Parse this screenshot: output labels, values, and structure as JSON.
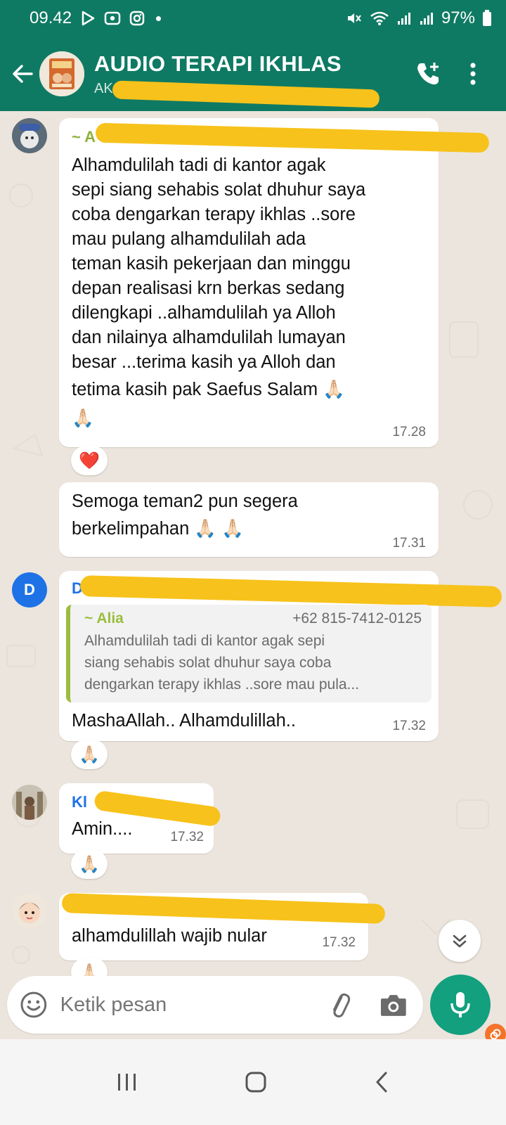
{
  "status_bar": {
    "time": "09.42",
    "battery": "97%"
  },
  "header": {
    "title": "AUDIO TERAPI IKHLAS",
    "subtitle": "AK"
  },
  "messages": [
    {
      "sender": "~ A",
      "text_lines": [
        "Alhamdulilah tadi di kantor agak",
        "sepi siang sehabis solat dhuhur saya",
        "coba dengarkan terapy ikhlas ..sore",
        "mau pulang alhamdulilah ada",
        "teman kasih pekerjaan dan minggu",
        "depan realisasi krn berkas sedang",
        "dilengkapi ..alhamdulilah ya Alloh",
        "dan nilainya alhamdulilah lumayan",
        "besar ...terima kasih  ya Alloh dan",
        "tetima kasih pak Saefus Salam 🙏🏻",
        "🙏🏻"
      ],
      "time": "17.28",
      "reaction": "❤️"
    },
    {
      "text_lines": [
        "Semoga teman2 pun segera",
        "berkelimpahan 🙏🏻 🙏🏻"
      ],
      "time": "17.31"
    },
    {
      "sender": "D",
      "avatar_letter": "D",
      "quote": {
        "name": "~ Alia",
        "phone": "+62 815-7412-0125",
        "text_lines": [
          "Alhamdulilah tadi di kantor agak sepi",
          "siang sehabis solat dhuhur saya coba",
          "dengarkan terapy ikhlas ..sore mau pula..."
        ]
      },
      "text": "MashaAllah.. Alhamdulillah..",
      "time": "17.32",
      "reaction": "🙏🏻"
    },
    {
      "sender": "Kl",
      "text": "Amin....",
      "time": "17.32",
      "reaction": "🙏🏻"
    },
    {
      "text": "alhamdulillah wajib nular",
      "time": "17.32",
      "reaction": "🙏🏻"
    }
  ],
  "input": {
    "placeholder": "Ketik pesan"
  },
  "colors": {
    "header": "#0f7a63",
    "chat_bg": "#ece5dd",
    "bubble": "#ffffff",
    "quote_accent": "#9bbd3e",
    "mic": "#12a07f",
    "redaction": "#f7c21b"
  },
  "icons": [
    "back-arrow-icon",
    "add-call-icon",
    "more-vert-icon",
    "emoji-icon",
    "attach-icon",
    "camera-icon",
    "mic-icon",
    "scroll-down-icon",
    "recents-icon",
    "home-icon",
    "back-icon"
  ]
}
